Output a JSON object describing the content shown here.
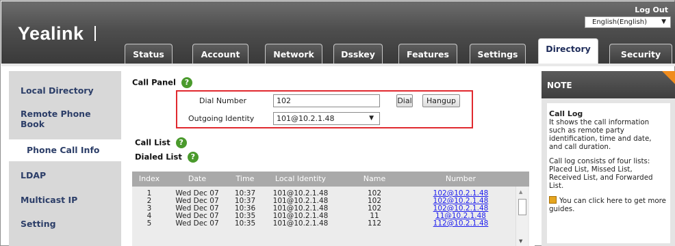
{
  "header": {
    "logo": "Yealink",
    "logout": "Log Out",
    "language": "English(English)"
  },
  "tabs": [
    {
      "label": "Status"
    },
    {
      "label": "Account"
    },
    {
      "label": "Network"
    },
    {
      "label": "Dsskey"
    },
    {
      "label": "Features"
    },
    {
      "label": "Settings"
    },
    {
      "label": "Directory",
      "active": true
    },
    {
      "label": "Security"
    }
  ],
  "sidebar": {
    "items": [
      {
        "label": "Local Directory"
      },
      {
        "label": "Remote Phone Book"
      },
      {
        "label": "Phone Call Info",
        "active": true
      },
      {
        "label": "LDAP"
      },
      {
        "label": "Multicast IP"
      },
      {
        "label": "Setting"
      }
    ]
  },
  "call_panel": {
    "title": "Call Panel",
    "dial_number_label": "Dial Number",
    "dial_number_value": "102",
    "outgoing_identity_label": "Outgoing Identity",
    "outgoing_identity_value": "101@10.2.1.48",
    "dial_button": "Dial",
    "hangup_button": "Hangup"
  },
  "call_list": {
    "title": "Call List",
    "dialed_title": "Dialed List",
    "columns": [
      "Index",
      "Date",
      "Time",
      "Local Identity",
      "Name",
      "Number"
    ],
    "rows": [
      [
        "1",
        "Wed Dec 07",
        "10:37",
        "101@10.2.1.48",
        "102",
        "102@10.2.1.48"
      ],
      [
        "2",
        "Wed Dec 07",
        "10:37",
        "101@10.2.1.48",
        "102",
        "102@10.2.1.48"
      ],
      [
        "3",
        "Wed Dec 07",
        "10:36",
        "101@10.2.1.48",
        "102",
        "102@10.2.1.48"
      ],
      [
        "4",
        "Wed Dec 07",
        "10:35",
        "101@10.2.1.48",
        "11",
        "11@10.2.1.48"
      ],
      [
        "5",
        "Wed Dec 07",
        "10:35",
        "101@10.2.1.48",
        "112",
        "112@10.2.1.48"
      ]
    ]
  },
  "note": {
    "title": "NOTE",
    "heading": "Call Log",
    "p1": "It shows the call information such as remote party identification, time and date, and call duration.",
    "p2": "Call log consists of four lists: Placed List, Missed List, Received List, and Forwarded List.",
    "guide": "You can click here to get more guides."
  },
  "colors": {
    "accent_orange": "#f08c1d",
    "highlight_red": "#e0282e",
    "help_green": "#4a9a2c",
    "link_blue": "#1a1aee"
  }
}
